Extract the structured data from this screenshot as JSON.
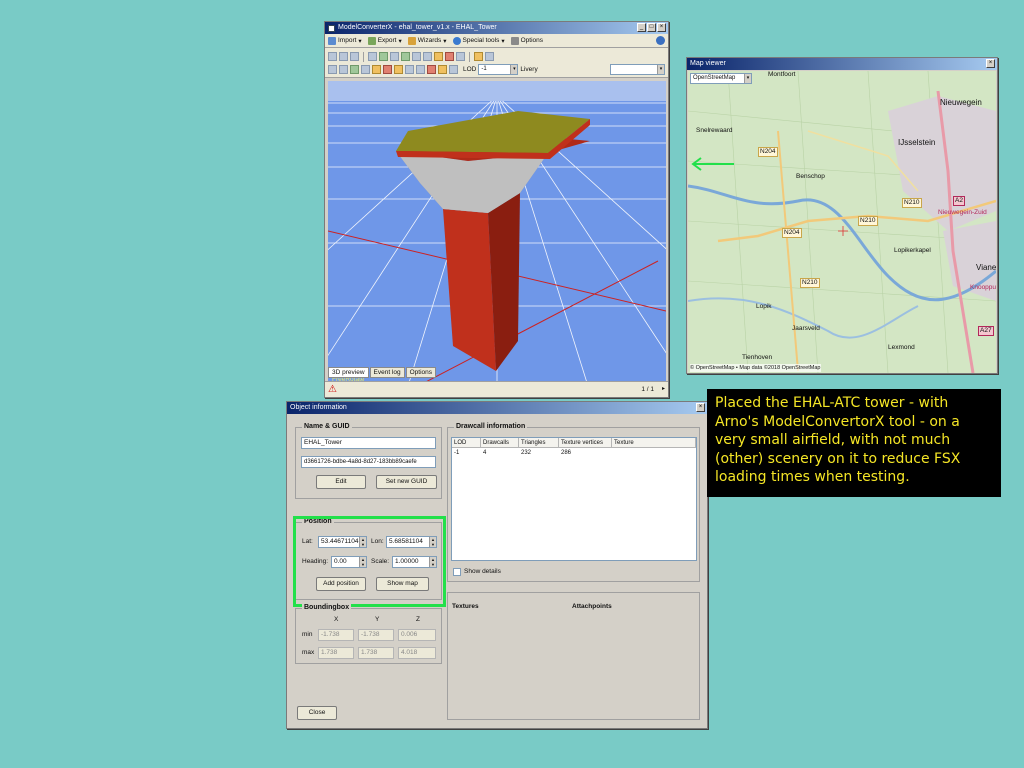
{
  "converter_window": {
    "title": "ModelConverterX - ehal_tower_v1.x - EHAL_Tower",
    "menu": [
      {
        "label": "Import",
        "icon": "import-icon"
      },
      {
        "label": "Export",
        "icon": "export-icon"
      },
      {
        "label": "Wizards",
        "icon": "wizard-icon"
      },
      {
        "label": "Special tools",
        "icon": "globe-icon"
      },
      {
        "label": "Options",
        "icon": "wrench-icon"
      }
    ],
    "lod_label": "LOD",
    "lod_value": "-1",
    "livery_label": "Livery",
    "preview_mode": "FreeRotate",
    "tabs": [
      "3D preview",
      "Event log",
      "Options"
    ],
    "page_indicator": "1 / 1",
    "colors": {
      "sky": "#6f97e8",
      "tower_body": "#c0301c",
      "roof": "#8e8a1f",
      "grid": "#ffffff"
    }
  },
  "map_viewer": {
    "title": "Map viewer",
    "source_select": "OpenStreetMap",
    "attribution": "© OpenStreetMap • Map data ©2018 OpenStreetMap",
    "places": [
      "Montfoort",
      "Nieuwegein",
      "Snelrewaard",
      "IJsselstein",
      "Benschop",
      "Nieuwegein-Zuid",
      "Lopikerkapel",
      "Vianen",
      "Lopik",
      "Jaarsveld",
      "Lexmond",
      "Tienhoven",
      "Knooppunt E"
    ],
    "roads": [
      "N204",
      "N210",
      "N204",
      "N210",
      "A2",
      "A27"
    ]
  },
  "object_info": {
    "title": "Object information",
    "name_group": {
      "title": "Name & GUID",
      "name": "EHAL_Tower",
      "guid": "d3661726-bdbe-4a8d-8d27-183bb89caefe",
      "edit_label": "Edit",
      "new_guid_label": "Set new GUID"
    },
    "position": {
      "title": "Position",
      "lat_label": "Lat:",
      "lat_value": "53.44671104",
      "lon_label": "Lon:",
      "lon_value": "5.68581104",
      "heading_label": "Heading:",
      "heading_value": "0.00",
      "scale_label": "Scale:",
      "scale_value": "1.00000",
      "add_label": "Add position",
      "map_label": "Show map"
    },
    "bbox": {
      "title": "Boundingbox",
      "cols": [
        "X",
        "Y",
        "Z"
      ],
      "min_label": "min",
      "max_label": "max",
      "min": [
        "-1.738",
        "-1.738",
        "0.006"
      ],
      "max": [
        "1.738",
        "1.738",
        "4.018"
      ]
    },
    "drawcall": {
      "title": "Drawcall information",
      "headers": [
        "LOD",
        "Drawcalls",
        "Triangles",
        "Texture vertices",
        "Texture"
      ],
      "row": [
        "-1",
        "4",
        "232",
        "286",
        ""
      ],
      "show_details_label": "Show details"
    },
    "textures_label": "Textures",
    "attachpoints_label": "Attachpoints",
    "close_label": "Close"
  },
  "note_text": "Placed the EHAL-ATC tower - with Arno's ModelConvertorX tool - on a very small airfield, with not much (other) scenery on it to reduce FSX loading times when testing.",
  "highlight_color": "#22e04a"
}
